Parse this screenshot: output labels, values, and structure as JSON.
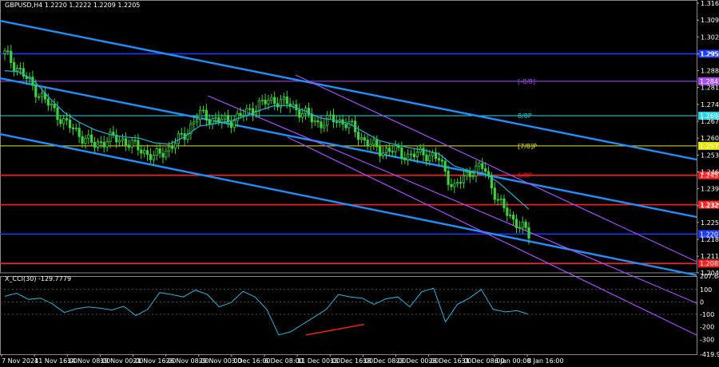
{
  "header": {
    "title": "GBPUSD,H4  1.2220 1.2222 1.2209 1.2205"
  },
  "indicator": {
    "title": "X_CCI(30) -129.7779"
  },
  "colors": {
    "background": "#000000",
    "candle": "#3cd33c",
    "ma": "#1fb1d6",
    "channel_main": "#1e90ff",
    "channel_secondary": "#a64dff",
    "level_red": "#ff2020",
    "level_blue": "#1e3cff",
    "cci": "#29b7d8",
    "divergence": "#ff2020"
  },
  "chart_data": [
    {
      "type": "candlestick",
      "title": "GBPUSD,H4",
      "x_tick_labels": [
        "7 Nov 2024",
        "11 Nov 16:00",
        "14 Nov 08:00",
        "19 Nov 00:00",
        "21 Nov 16:00",
        "26 Nov 08:00",
        "29 Nov 00:00",
        "3 Dec 16:00",
        "6 Dec 08:00",
        "11 Dec 00:00",
        "13 Dec 16:00",
        "18 Dec 08:00",
        "23 Dec 00:00",
        "26 Dec 16:00",
        "31 Dec 08:00",
        "6 Jan 00:00",
        "8 Jan 16:00"
      ],
      "y_tick_labels": [
        "1.3165",
        "1.3095",
        "1.3025",
        "1.2955",
        "1.2885",
        "1.2815",
        "1.2745",
        "1.2675",
        "1.2605",
        "1.2535",
        "1.2465",
        "1.2395",
        "1.2325",
        "1.2255",
        "1.2185",
        "1.2115",
        "1.2046"
      ],
      "ylim": [
        1.2046,
        1.3165
      ],
      "close": [
        1.2955,
        1.2885,
        1.281,
        1.274,
        1.267,
        1.262,
        1.2575,
        1.2605,
        1.2595,
        1.256,
        1.2525,
        1.2565,
        1.262,
        1.2705,
        1.268,
        1.2675,
        1.2705,
        1.2745,
        1.2765,
        1.2745,
        1.2705,
        1.2665,
        1.2685,
        1.266,
        1.2595,
        1.2555,
        1.2555,
        1.253,
        1.2545,
        1.2515,
        1.2395,
        1.2465,
        1.2485,
        1.2335,
        1.2265,
        1.2205
      ],
      "ma_values": [
        1.2885,
        1.288,
        1.284,
        1.277,
        1.271,
        1.267,
        1.264,
        1.262,
        1.261,
        1.2605,
        1.2585,
        1.258,
        1.261,
        1.2655,
        1.2665,
        1.2675,
        1.2695,
        1.272,
        1.274,
        1.274,
        1.272,
        1.269,
        1.268,
        1.2665,
        1.263,
        1.2595,
        1.258,
        1.2565,
        1.2555,
        1.254,
        1.249,
        1.247,
        1.246,
        1.242,
        1.2365,
        1.231
      ],
      "levels": [
        {
          "price": "1.2955",
          "label": "",
          "color": "#1e3cff"
        },
        {
          "price": "1.2841",
          "label": "[-8/8]",
          "color": "#a64dff"
        },
        {
          "price": "1.2698",
          "label": "8/8P",
          "color": "#29d8e8"
        },
        {
          "price": "1.2573",
          "label": "[7/8]P",
          "color": "#e8e800"
        },
        {
          "price": "1.2451",
          "label": "6/8P",
          "color": "#ff2020"
        },
        {
          "price": "1.2329",
          "label": "",
          "color": "#ff2020"
        },
        {
          "price": "1.2207",
          "label": "",
          "color": "#1e3cff"
        },
        {
          "price": "1.2085",
          "label": "",
          "color": "#ff2020"
        }
      ]
    },
    {
      "type": "line",
      "title": "X_CCI(30) -129.7779",
      "y_tick_labels": [
        "207.6441",
        "100",
        "0",
        "-100",
        "-200",
        "-300",
        "-419.954"
      ],
      "ylim": [
        -419.954,
        207.6441
      ],
      "values": [
        45,
        70,
        20,
        30,
        -15,
        -85,
        -55,
        -40,
        -50,
        -65,
        -35,
        -110,
        -60,
        75,
        60,
        40,
        95,
        60,
        -40,
        -5,
        85,
        40,
        -60,
        -265,
        -240,
        -180,
        -120,
        -60,
        60,
        40,
        30,
        -20,
        25,
        40,
        -40,
        80,
        110,
        -160,
        -20,
        30,
        100,
        -60,
        -80,
        -70,
        -100
      ]
    }
  ]
}
